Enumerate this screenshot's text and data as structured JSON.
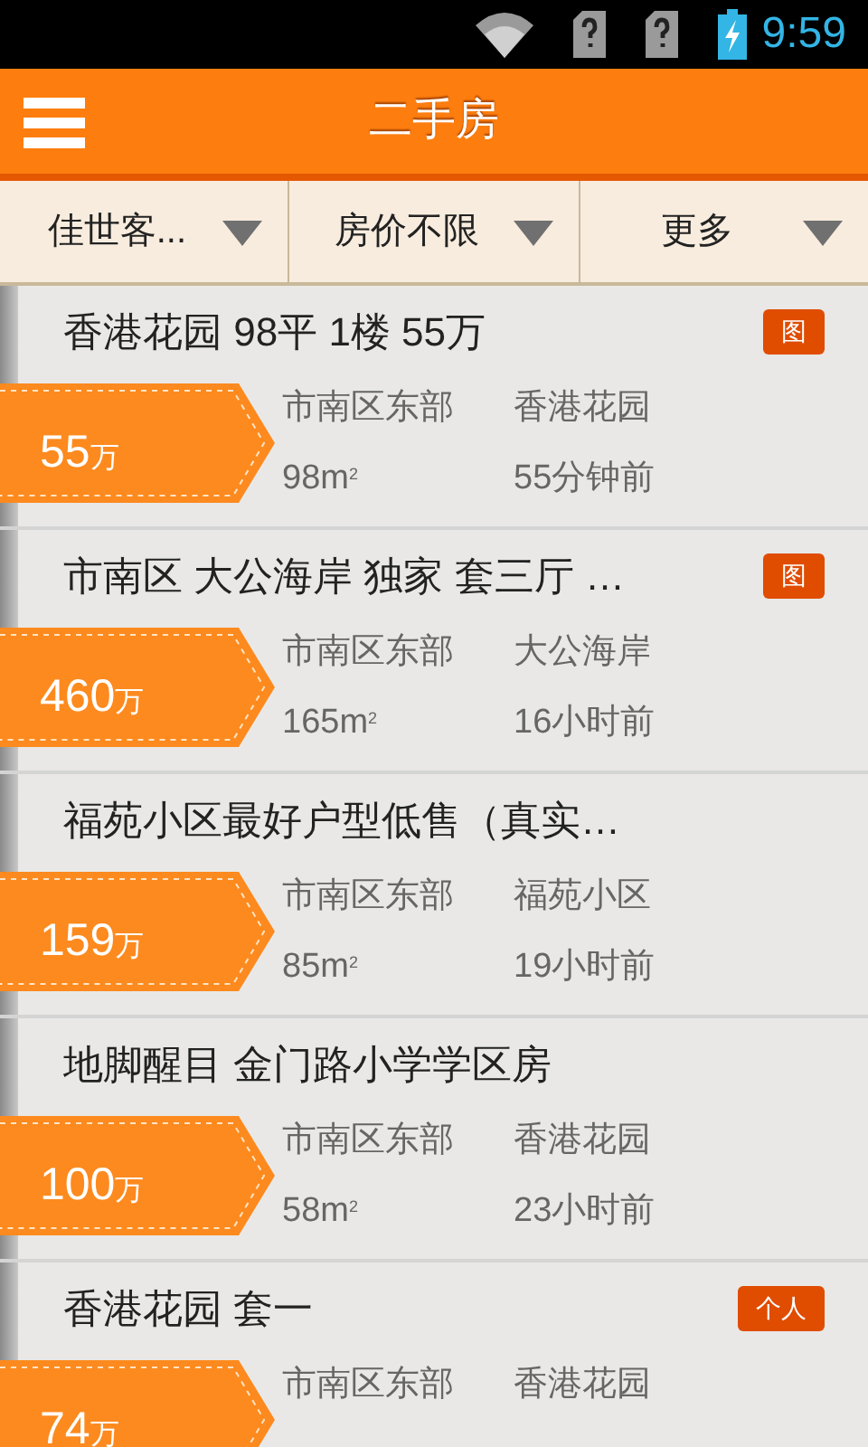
{
  "status_bar": {
    "time": "9:59"
  },
  "header": {
    "title": "二手房"
  },
  "filters": [
    {
      "label": "佳世客..."
    },
    {
      "label": "房价不限"
    },
    {
      "label": "更多"
    }
  ],
  "listings": [
    {
      "title": "香港花园 98平 1楼 55万",
      "badge": "图",
      "price": "55",
      "unit": "万",
      "district": "市南区东部",
      "community": "香港花园",
      "area": "98m$^{2}$",
      "time": "55分钟前"
    },
    {
      "title": "市南区 大公海岸 独家 套三厅 …",
      "badge": "图",
      "price": "460",
      "unit": "万",
      "district": "市南区东部",
      "community": "大公海岸",
      "area": "165m$^{2}$",
      "time": "16小时前"
    },
    {
      "title": "福苑小区最好户型低售（真实…",
      "price": "159",
      "unit": "万",
      "district": "市南区东部",
      "community": "福苑小区",
      "area": "85m$^{2}$",
      "time": "19小时前"
    },
    {
      "title": "地脚醒目 金门路小学学区房",
      "price": "100",
      "unit": "万",
      "district": "市南区东部",
      "community": "香港花园",
      "area": "58m$^{2}$",
      "time": "23小时前"
    },
    {
      "title": "香港花园 套一",
      "badge": "个人",
      "price": "74",
      "unit": "万",
      "district": "市南区东部",
      "community": "香港花园"
    }
  ]
}
